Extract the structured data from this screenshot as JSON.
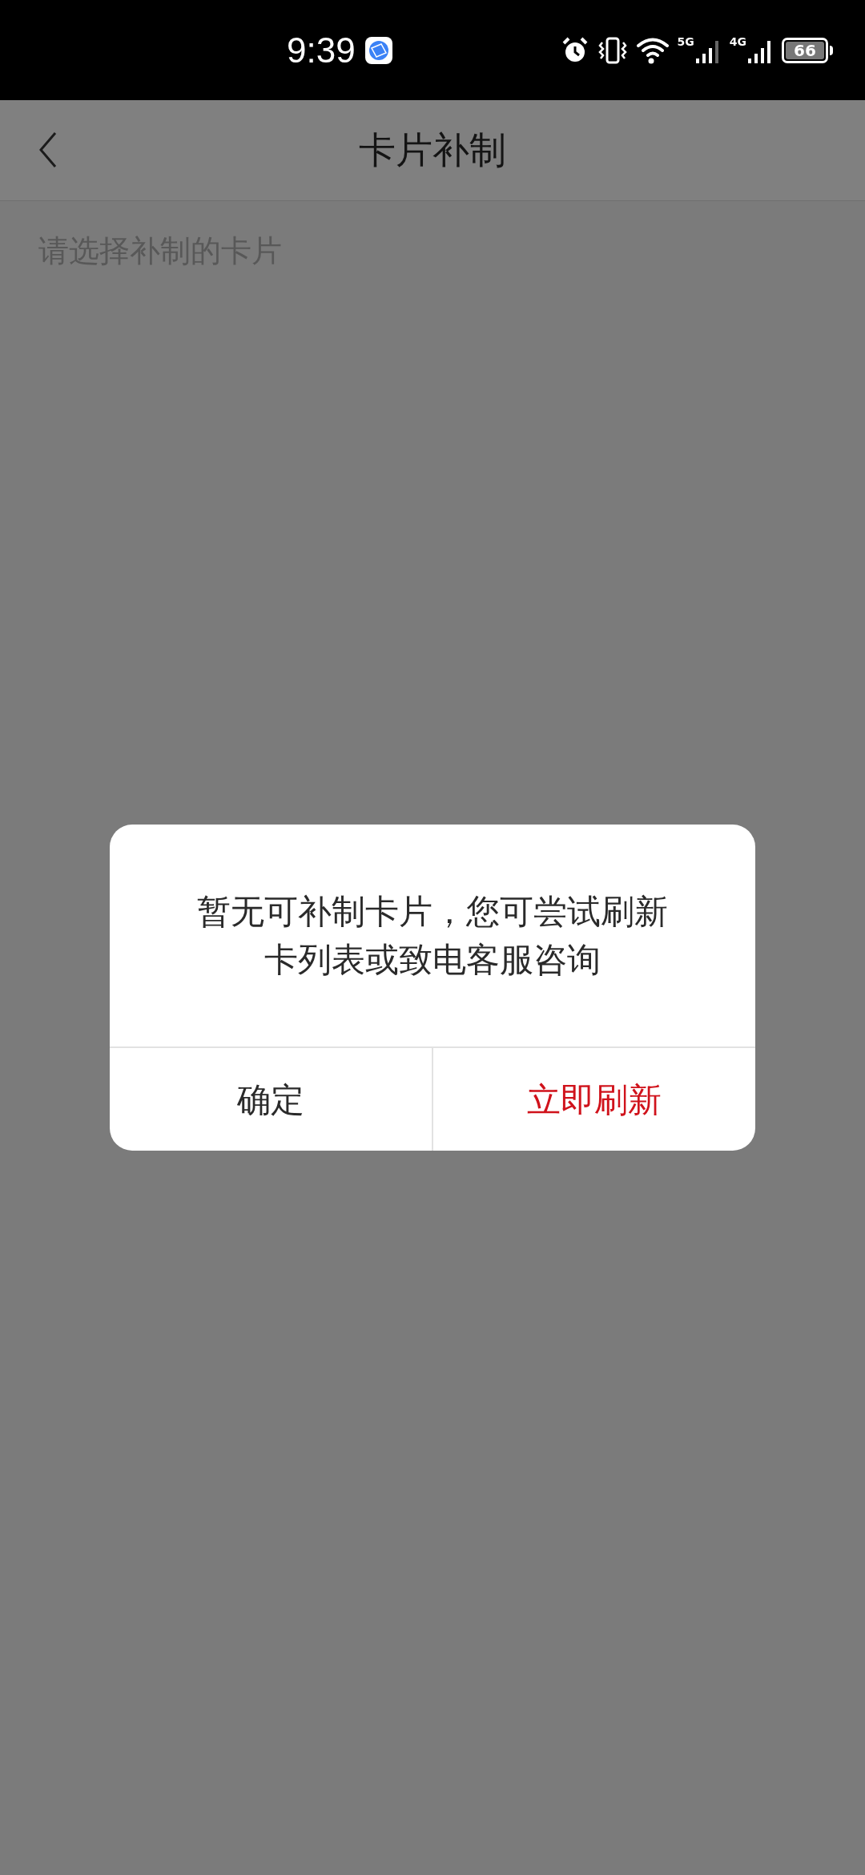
{
  "status_bar": {
    "time": "9:39",
    "sim1": "5G",
    "sim2": "4G",
    "battery": "66"
  },
  "header": {
    "title": "卡片补制"
  },
  "subtitle": "请选择补制的卡片",
  "dialog": {
    "message": "暂无可补制卡片，您可尝试刷新卡列表或致电客服咨询",
    "buttons": [
      {
        "label": "确定",
        "kind": "cancel"
      },
      {
        "label": "立即刷新",
        "kind": "confirm"
      }
    ]
  }
}
